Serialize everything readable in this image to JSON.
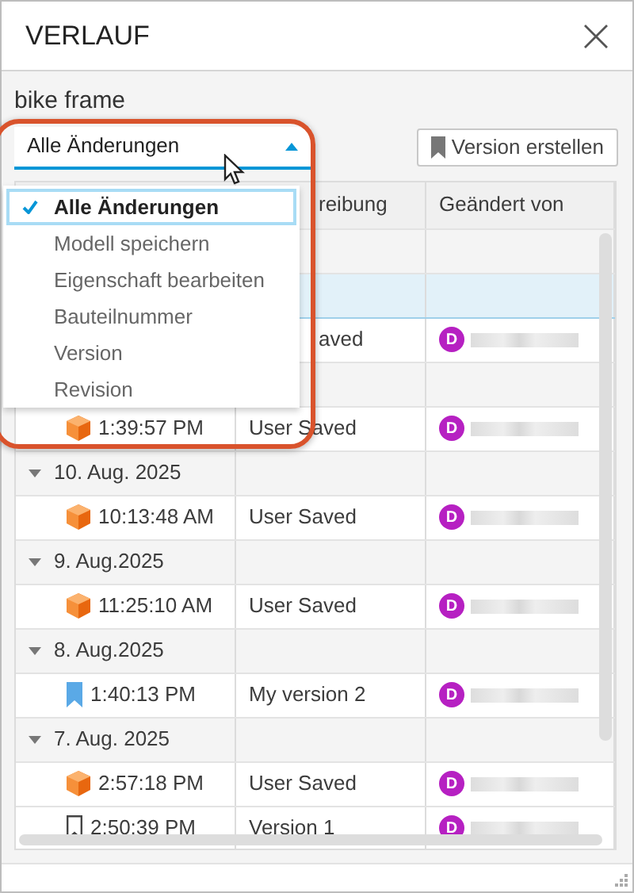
{
  "window": {
    "title": "VERLAUF"
  },
  "document": {
    "name": "bike frame"
  },
  "filter": {
    "value": "Alle Änderungen",
    "expanded": true,
    "options": [
      {
        "label": "Alle Änderungen",
        "selected": true
      },
      {
        "label": "Modell speichern",
        "selected": false
      },
      {
        "label": "Eigenschaft bearbeiten",
        "selected": false
      },
      {
        "label": "Bauteilnummer",
        "selected": false
      },
      {
        "label": "Version",
        "selected": false
      },
      {
        "label": "Revision",
        "selected": false
      }
    ]
  },
  "create_button": {
    "label": "Version erstellen"
  },
  "table": {
    "columns": [
      "reibung",
      "Geändert von"
    ],
    "rows": [
      {
        "kind": "group",
        "selected": false
      },
      {
        "kind": "group",
        "selected": true
      },
      {
        "kind": "entry",
        "selected": false,
        "description": "aved",
        "user_initial": "D"
      },
      {
        "kind": "group",
        "selected": false
      },
      {
        "kind": "model_save",
        "selected": false,
        "time": "1:39:57 PM",
        "description": "User Saved",
        "user_initial": "D"
      },
      {
        "kind": "group",
        "selected": false,
        "expanded": true,
        "date": "10. Aug. 2025"
      },
      {
        "kind": "model_save",
        "selected": false,
        "time": "10:13:48 AM",
        "description": "User Saved",
        "user_initial": "D"
      },
      {
        "kind": "group",
        "selected": false,
        "expanded": true,
        "date": "9. Aug.2025"
      },
      {
        "kind": "model_save",
        "selected": false,
        "time": "11:25:10 AM",
        "description": "User Saved",
        "user_initial": "D"
      },
      {
        "kind": "group",
        "selected": false,
        "expanded": true,
        "date": "8. Aug.2025"
      },
      {
        "kind": "version",
        "selected": false,
        "time": "1:40:13 PM",
        "description": "My version 2",
        "user_initial": "D"
      },
      {
        "kind": "group",
        "selected": false,
        "expanded": true,
        "date": "7. Aug. 2025"
      },
      {
        "kind": "model_save",
        "selected": false,
        "time": "2:57:18 PM",
        "description": "User Saved",
        "user_initial": "D"
      },
      {
        "kind": "milestone",
        "selected": false,
        "time": "2:50:39 PM",
        "description": "Version 1",
        "user_initial": "D"
      }
    ]
  }
}
